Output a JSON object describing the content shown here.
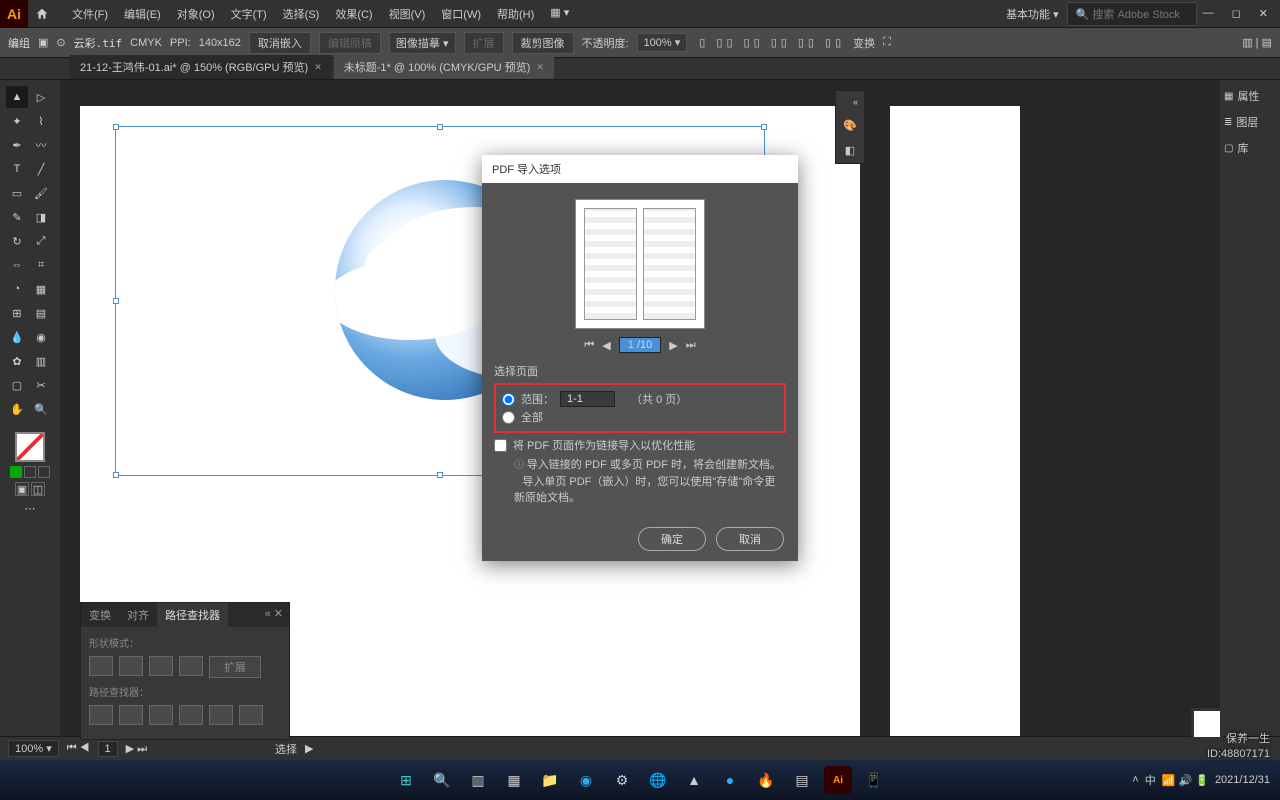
{
  "menubar": {
    "items": [
      "文件(F)",
      "编辑(E)",
      "对象(O)",
      "文字(T)",
      "选择(S)",
      "效果(C)",
      "视图(V)",
      "窗口(W)",
      "帮助(H)"
    ],
    "workspace": "基本功能",
    "search_placeholder": "搜索 Adobe Stock"
  },
  "options": {
    "group_label": "编组",
    "filename": "云彩.tif",
    "colormode": "CMYK",
    "ppi_label": "PPI:",
    "ppi_value": "140x162",
    "cancel_embed": "取消嵌入",
    "edit_original": "编辑原稿",
    "image_trace": "图像描摹",
    "expand": "扩展",
    "crop": "裁剪图像",
    "opacity_label": "不透明度:",
    "opacity_value": "100%",
    "transform": "变换"
  },
  "tabs": [
    {
      "label": "21-12-王鸿伟-01.ai* @ 150% (RGB/GPU 预览)",
      "active": false
    },
    {
      "label": "未标题-1* @ 100% (CMYK/GPU 预览)",
      "active": true
    }
  ],
  "right_panels": [
    "属性",
    "图层",
    "库"
  ],
  "pathfinder": {
    "tabs": [
      "变换",
      "对齐",
      "路径查找器"
    ],
    "shape_modes": "形状模式：",
    "expand": "扩展",
    "pathfinders": "路径查找器："
  },
  "dialog": {
    "title": "PDF 导入选项",
    "page_current": "1",
    "page_total": "/10",
    "select_pages": "选择页面",
    "range_label": "范围：",
    "range_value": "1-1",
    "total_hint_l": "（共",
    "total_hint_n": "0",
    "total_hint_r": "页）",
    "all_label": "全部",
    "link_checkbox": "将 PDF 页面作为链接导入以优化性能",
    "info1": "导入链接的 PDF 或多页 PDF 时，将会创建新文档。",
    "info2": "导入单页 PDF（嵌入）时，您可以使用\"存储\"命令更新原始文档。",
    "ok": "确定",
    "cancel": "取消"
  },
  "status": {
    "zoom": "100%",
    "artboard": "1",
    "tool": "选择"
  },
  "watermark": {
    "brand": "保养一生",
    "id": "ID:48807171"
  },
  "taskbar": {
    "time": "2021/12/31"
  }
}
